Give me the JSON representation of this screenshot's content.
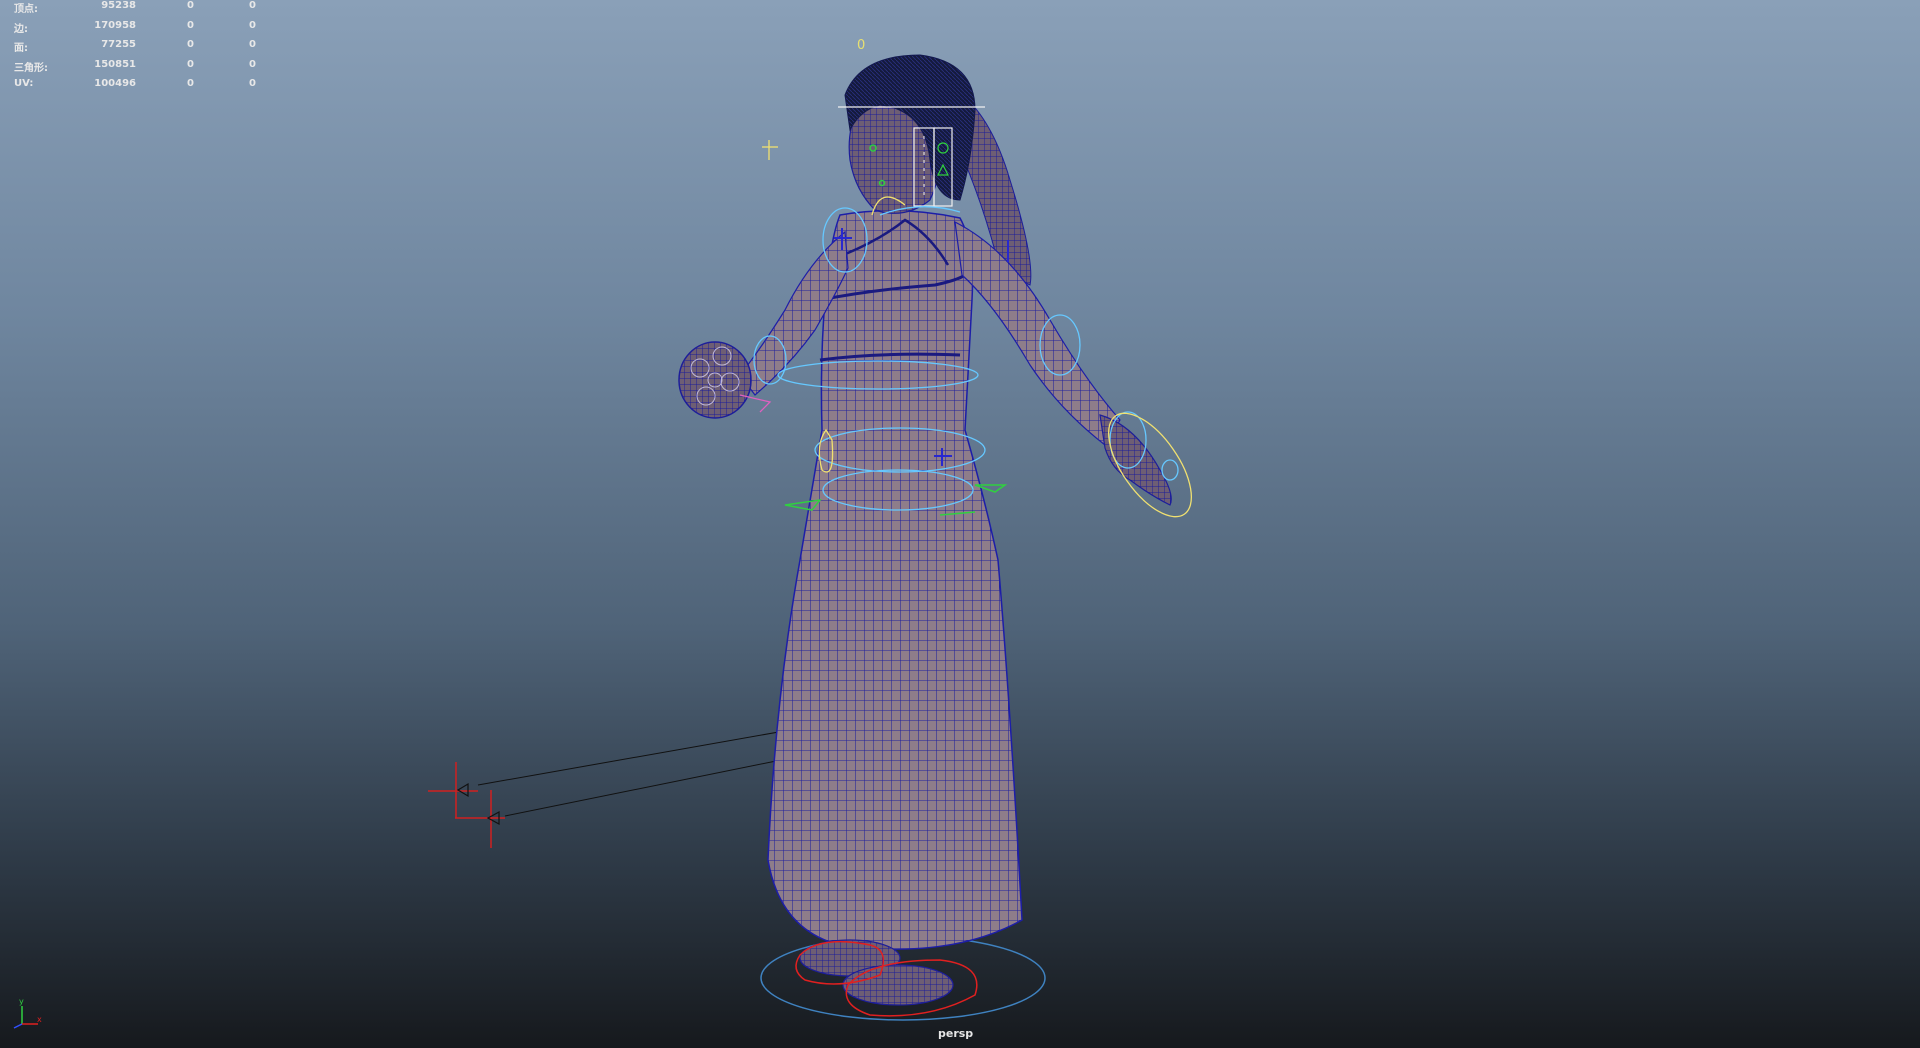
{
  "viewport": {
    "camera": "persp",
    "frame_marker": "0"
  },
  "hud": {
    "rows": [
      {
        "label": "顶点:",
        "v1": "95238",
        "v2": "0",
        "v3": "0"
      },
      {
        "label": "边:",
        "v1": "170958",
        "v2": "0",
        "v3": "0"
      },
      {
        "label": "面:",
        "v1": "77255",
        "v2": "0",
        "v3": "0"
      },
      {
        "label": "三角形:",
        "v1": "150851",
        "v2": "0",
        "v3": "0"
      },
      {
        "label": "UV:",
        "v1": "100496",
        "v2": "0",
        "v3": "0"
      }
    ]
  },
  "axis": {
    "y": "y",
    "x": "x"
  },
  "colors": {
    "mesh_fill": "#8a7a86",
    "wire": "#1d1ea8",
    "control_cyan": "#66c8ff",
    "control_yellow": "#f0e070",
    "control_red": "#e02020",
    "control_green": "#30d040",
    "hair": "#161a40"
  }
}
